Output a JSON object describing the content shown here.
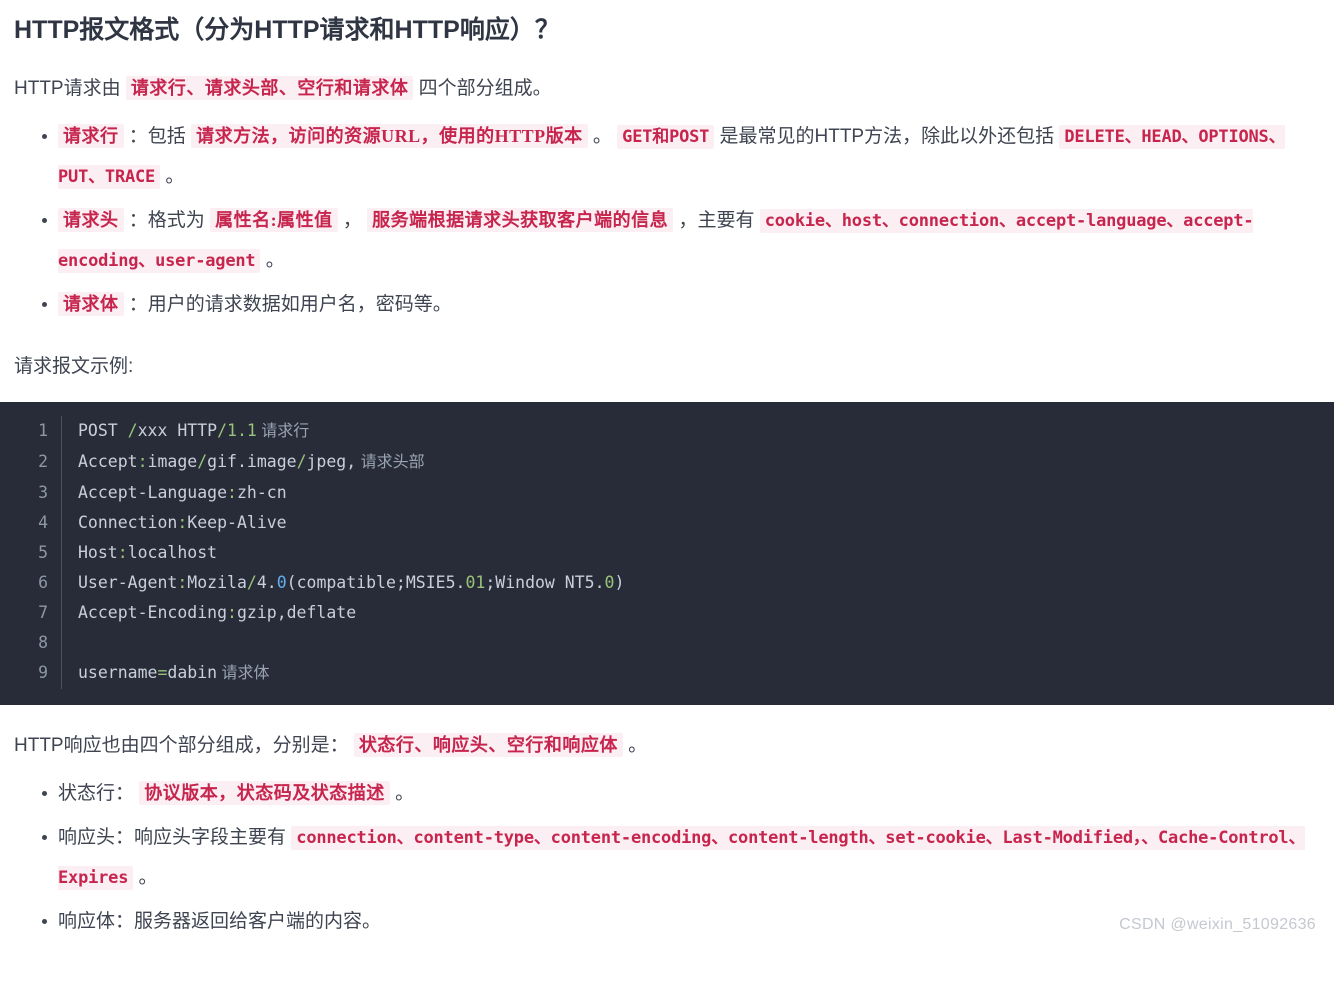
{
  "document": {
    "title": "HTTP报文格式（分为HTTP请求和HTTP响应）？",
    "watermark": "CSDN @weixin_51092636"
  },
  "colors": {
    "inline_code_bg": "#fbeff3",
    "inline_code_fg": "#c7254e",
    "code_block_bg": "#272c38",
    "code_text": "#c3cad6",
    "code_green": "#98c379",
    "code_blue": "#61afef",
    "code_comment": "#9aa3b2",
    "body_text": "#3f4451",
    "heading_text": "#2f3542"
  },
  "request_section": {
    "intro": {
      "before": "HTTP请求由",
      "code": "请求行、请求头部、空行和请求体",
      "after": "四个部分组成。"
    },
    "bullets": [
      {
        "name": "request-line",
        "parts": [
          {
            "type": "code-serif",
            "text": "请求行"
          },
          {
            "type": "text",
            "text": "：包括"
          },
          {
            "type": "code-serif",
            "text": "请求方法，访问的资源URL，使用的HTTP版本"
          },
          {
            "type": "text",
            "text": "。"
          },
          {
            "type": "code-mono",
            "text": "GET和POST"
          },
          {
            "type": "text",
            "text": "是最常见的HTTP方法，除此以外还包括"
          },
          {
            "type": "code-mono",
            "text": "DELETE、HEAD、OPTIONS、PUT、TRACE"
          },
          {
            "type": "text",
            "text": "。"
          }
        ]
      },
      {
        "name": "request-header",
        "parts": [
          {
            "type": "code-serif",
            "text": "请求头"
          },
          {
            "type": "text",
            "text": "：格式为"
          },
          {
            "type": "code-serif",
            "text": "属性名:属性值"
          },
          {
            "type": "text",
            "text": "，"
          },
          {
            "type": "code-serif",
            "text": "服务端根据请求头获取客户端的信息"
          },
          {
            "type": "text",
            "text": "，主要有"
          },
          {
            "type": "code-mono",
            "text": "cookie、host、connection、accept-language、accept-encoding、user-agent"
          },
          {
            "type": "text",
            "text": "。"
          }
        ]
      },
      {
        "name": "request-body",
        "parts": [
          {
            "type": "code-serif",
            "text": "请求体"
          },
          {
            "type": "text",
            "text": "：用户的请求数据如用户名，密码等。"
          }
        ]
      }
    ],
    "example_label": "请求报文示例:"
  },
  "code_block": {
    "lines": [
      {
        "number": "1",
        "tokens": [
          {
            "cls": "tok-plain",
            "text": "POST "
          },
          {
            "cls": "tok-green",
            "text": "/"
          },
          {
            "cls": "tok-plain",
            "text": "xxx HTTP"
          },
          {
            "cls": "tok-green",
            "text": "/1.1"
          },
          {
            "cls": "cmt-cn",
            "text": " 请求行"
          }
        ]
      },
      {
        "number": "2",
        "tokens": [
          {
            "cls": "tok-plain",
            "text": "Accept"
          },
          {
            "cls": "tok-green",
            "text": ":"
          },
          {
            "cls": "tok-plain",
            "text": "image"
          },
          {
            "cls": "tok-green",
            "text": "/"
          },
          {
            "cls": "tok-plain",
            "text": "gif.image"
          },
          {
            "cls": "tok-green",
            "text": "/"
          },
          {
            "cls": "tok-plain",
            "text": "jpeg,"
          },
          {
            "cls": "cmt-cn",
            "text": " 请求头部"
          }
        ]
      },
      {
        "number": "3",
        "tokens": [
          {
            "cls": "tok-plain",
            "text": "Accept-Language"
          },
          {
            "cls": "tok-green",
            "text": ":"
          },
          {
            "cls": "tok-plain",
            "text": "zh-cn"
          }
        ]
      },
      {
        "number": "4",
        "tokens": [
          {
            "cls": "tok-plain",
            "text": "Connection"
          },
          {
            "cls": "tok-green",
            "text": ":"
          },
          {
            "cls": "tok-plain",
            "text": "Keep-Alive"
          }
        ]
      },
      {
        "number": "5",
        "tokens": [
          {
            "cls": "tok-plain",
            "text": "Host"
          },
          {
            "cls": "tok-green",
            "text": ":"
          },
          {
            "cls": "tok-plain",
            "text": "localhost"
          }
        ]
      },
      {
        "number": "6",
        "tokens": [
          {
            "cls": "tok-plain",
            "text": "User-Agent"
          },
          {
            "cls": "tok-green",
            "text": ":"
          },
          {
            "cls": "tok-plain",
            "text": "Mozila"
          },
          {
            "cls": "tok-green",
            "text": "/"
          },
          {
            "cls": "tok-plain",
            "text": "4."
          },
          {
            "cls": "tok-blue",
            "text": "0"
          },
          {
            "cls": "tok-plain",
            "text": "(compatible;MSIE5."
          },
          {
            "cls": "tok-green",
            "text": "01"
          },
          {
            "cls": "tok-plain",
            "text": ";Window NT5."
          },
          {
            "cls": "tok-green",
            "text": "0"
          },
          {
            "cls": "tok-plain",
            "text": ")"
          }
        ]
      },
      {
        "number": "7",
        "tokens": [
          {
            "cls": "tok-plain",
            "text": "Accept-Encoding"
          },
          {
            "cls": "tok-green",
            "text": ":"
          },
          {
            "cls": "tok-plain",
            "text": "gzip,deflate"
          }
        ]
      },
      {
        "number": "8",
        "tokens": [
          {
            "cls": "tok-plain",
            "text": ""
          }
        ]
      },
      {
        "number": "9",
        "tokens": [
          {
            "cls": "tok-plain",
            "text": "username"
          },
          {
            "cls": "tok-green",
            "text": "="
          },
          {
            "cls": "tok-plain",
            "text": "dabin"
          },
          {
            "cls": "cmt-cn",
            "text": " 请求体"
          }
        ]
      }
    ]
  },
  "response_section": {
    "intro": {
      "before": "HTTP响应也由四个部分组成，分别是：",
      "code": "状态行、响应头、空行和响应体",
      "after": "。"
    },
    "bullets": [
      {
        "name": "status-line",
        "parts": [
          {
            "type": "text",
            "text": "状态行："
          },
          {
            "type": "code-serif",
            "text": "协议版本，状态码及状态描述"
          },
          {
            "type": "text",
            "text": "。"
          }
        ]
      },
      {
        "name": "response-header",
        "parts": [
          {
            "type": "text",
            "text": "响应头：响应头字段主要有"
          },
          {
            "type": "code-mono",
            "text": "connection、content-type、content-encoding、content-length、set-cookie、Last-Modified，、Cache-Control、Expires"
          },
          {
            "type": "text",
            "text": "。"
          }
        ]
      },
      {
        "name": "response-body",
        "parts": [
          {
            "type": "text",
            "text": "响应体：服务器返回给客户端的内容。"
          }
        ]
      }
    ]
  }
}
